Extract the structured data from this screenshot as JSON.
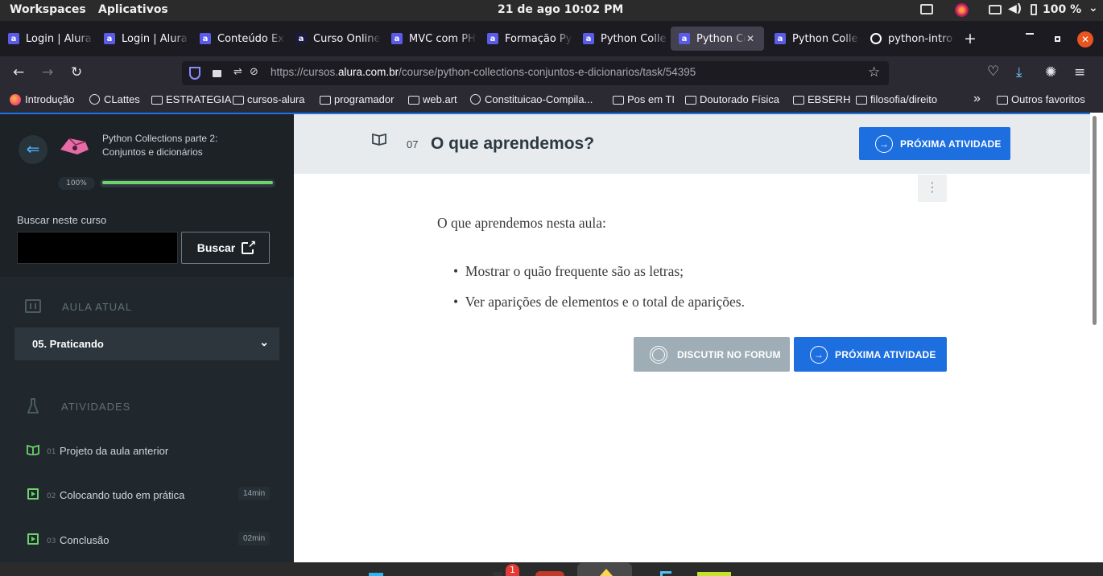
{
  "system": {
    "workspaces": "Workspaces",
    "apps": "Aplicativos",
    "datetime": "21 de ago  10:02 PM",
    "battery": "100 %"
  },
  "tabs": [
    {
      "title": "Login | Alura",
      "fav": "a"
    },
    {
      "title": "Login | Alura",
      "fav": "a"
    },
    {
      "title": "Conteúdo Ex",
      "fav": "a"
    },
    {
      "title": "Curso Online",
      "fav": "a"
    },
    {
      "title": "MVC com PH",
      "fav": "a"
    },
    {
      "title": "Formação Py",
      "fav": "a"
    },
    {
      "title": "Python Colle",
      "fav": "a"
    },
    {
      "title": "Python Co",
      "fav": "a"
    },
    {
      "title": "Python Colle",
      "fav": "a"
    },
    {
      "title": "python-intro",
      "fav": "gh"
    }
  ],
  "url": {
    "prefix": "https://cursos.",
    "domain": "alura.com.br",
    "path": "/course/python-collections-conjuntos-e-dicionarios/task/54395"
  },
  "bookmarks": {
    "items": [
      "Introdução",
      "CLattes",
      "ESTRATEGIA",
      "cursos-alura",
      "programador",
      "web.art",
      "Constituicao-Compila...",
      "Pos em TI",
      "Doutorado Física",
      "EBSERH",
      "filosofia/direito"
    ],
    "other": "Outros favoritos"
  },
  "sidebar": {
    "course_title_1": "Python Collections parte 2:",
    "course_title_2": "Conjuntos e dicionários",
    "progress_label": "100%",
    "progress": 1.0,
    "search_label": "Buscar neste curso",
    "search_button": "Buscar",
    "current_lesson_header": "AULA ATUAL",
    "current_lesson": "05. Praticando",
    "activities_header": "ATIVIDADES",
    "activities": [
      {
        "num": "01",
        "label": "Projeto da aula anterior",
        "duration": ""
      },
      {
        "num": "02",
        "label": "Colocando tudo em prática",
        "duration": "14min"
      },
      {
        "num": "03",
        "label": "Conclusão",
        "duration": "02min"
      }
    ]
  },
  "content": {
    "task_number": "07",
    "task_title": "O que aprendemos?",
    "next_button": "PRÓXIMA ATIVIDADE",
    "intro": "O que aprendemos nesta aula:",
    "bullets": [
      "Mostrar o quão frequente são as letras;",
      "Ver aparições de elementos e o total de aparições."
    ],
    "forum_button": "DISCUTIR NO FORUM",
    "next_button_bottom": "PRÓXIMA ATIVIDADE"
  },
  "dock": {
    "badge": "1"
  },
  "colors": {
    "accent": "#1d6fe0",
    "progress": "#6bd46b",
    "sidebar": "#1c2226"
  }
}
